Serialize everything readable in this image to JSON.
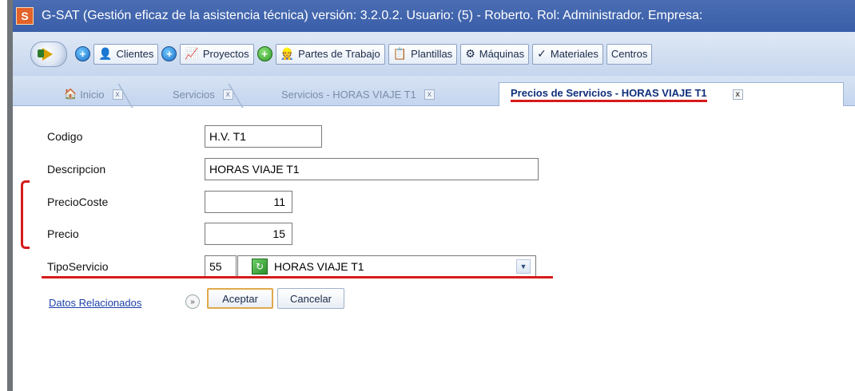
{
  "window": {
    "title": "G-SAT (Gestión eficaz de la asistencia técnica) versión: 3.2.0.2. Usuario:  (5) - Roberto. Rol: Administrador. Empresa:"
  },
  "toolbar": {
    "items": [
      {
        "label": "Clientes",
        "icon": "client-icon"
      },
      {
        "label": "Proyectos",
        "icon": "projects-icon"
      },
      {
        "label": "Partes de Trabajo",
        "icon": "worker-icon"
      },
      {
        "label": "Plantillas",
        "icon": "template-icon"
      },
      {
        "label": "Máquinas",
        "icon": "machine-icon"
      },
      {
        "label": "Materiales",
        "icon": "materials-icon"
      },
      {
        "label": "Centros",
        "icon": "centers-icon"
      }
    ]
  },
  "tabs": [
    {
      "label": "Inicio",
      "active": false
    },
    {
      "label": "Servicios",
      "active": false
    },
    {
      "label": "Servicios - HORAS VIAJE T1",
      "active": false
    },
    {
      "label": "Precios de Servicios - HORAS VIAJE T1",
      "active": true
    }
  ],
  "form": {
    "codigo": {
      "label": "Codigo",
      "value": "H.V. T1"
    },
    "descripcion": {
      "label": "Descripcion",
      "value": "HORAS VIAJE T1"
    },
    "precio_coste": {
      "label": "PrecioCoste",
      "value": "11"
    },
    "precio": {
      "label": "Precio",
      "value": "15"
    },
    "tipo_servicio": {
      "label": "TipoServicio",
      "code": "55",
      "value": "HORAS VIAJE T1"
    }
  },
  "actions": {
    "related_link": "Datos Relacionados",
    "accept": "Aceptar",
    "cancel": "Cancelar"
  },
  "colors": {
    "titlebar": "#3a5ea8",
    "annotation_red": "#d51b1b",
    "active_tab_text": "#0f2f7a"
  }
}
